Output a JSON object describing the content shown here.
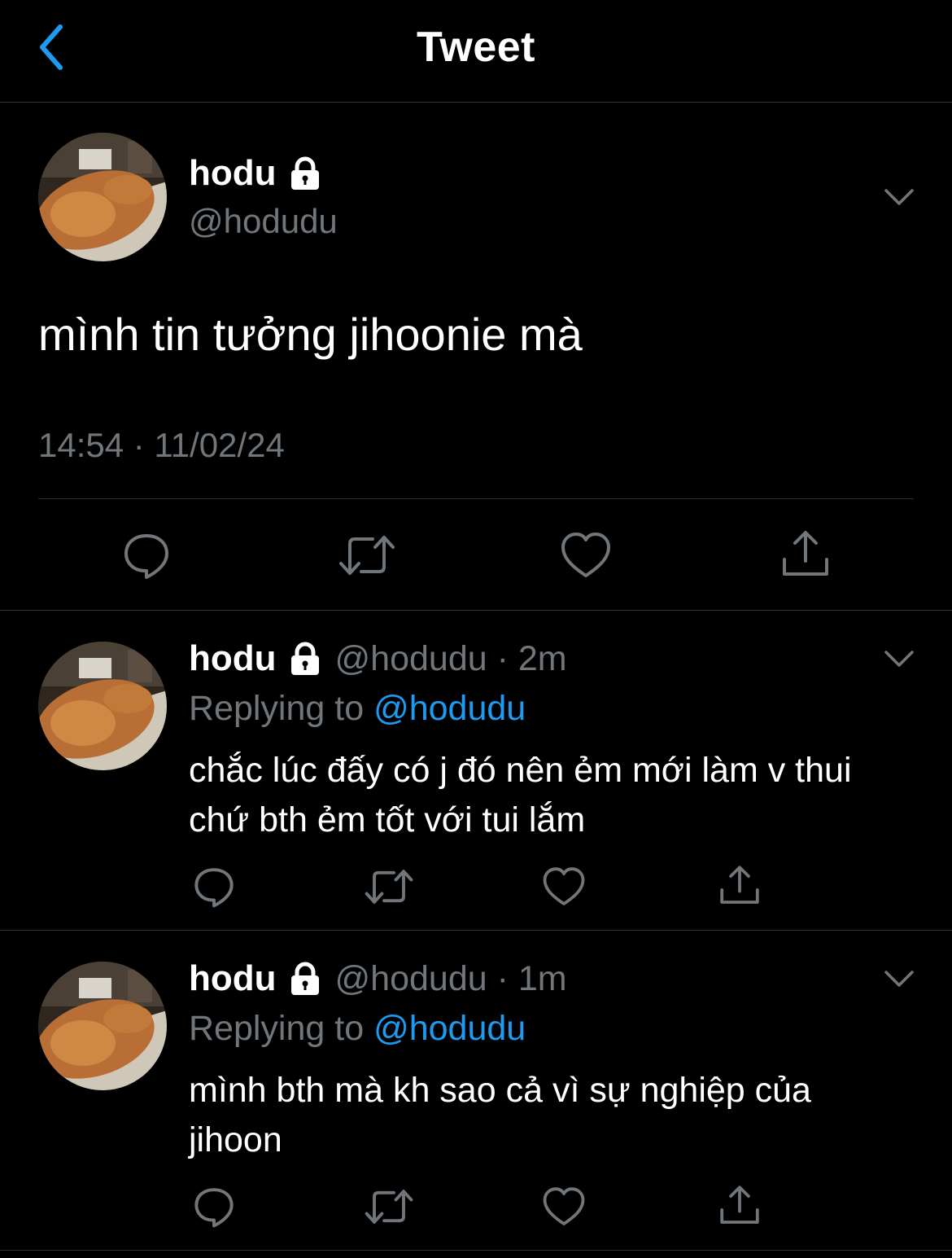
{
  "header": {
    "title": "Tweet",
    "back_icon": "chevron-left-icon",
    "accent": "#1d9bf0"
  },
  "main_tweet": {
    "name": "hodu",
    "handle": "@hodudu",
    "text": "mình tin tưởng jihoonie mà",
    "timestamp": "14:54 · 11/02/24",
    "icons": [
      "lock-icon",
      "chevron-down-icon",
      "reply-icon",
      "retweet-icon",
      "like-icon",
      "share-icon"
    ]
  },
  "replies": [
    {
      "name": "hodu",
      "meta": "@hodudu · 2m",
      "replying_prefix": "Replying to ",
      "replying_handle": "@hodudu",
      "text": "chắc lúc đấy có j đó nên ẻm mới làm v thui chứ bth ẻm tốt với tui lắm"
    },
    {
      "name": "hodu",
      "meta": "@hodudu · 1m",
      "replying_prefix": "Replying to ",
      "replying_handle": "@hodudu",
      "text": "mình bth mà kh sao cả vì sự nghiệp của jihoon"
    }
  ],
  "colors": {
    "background": "#000000",
    "text": "#ffffff",
    "secondary": "#71767b",
    "link": "#1d9bf0",
    "divider": "#2f3336"
  }
}
